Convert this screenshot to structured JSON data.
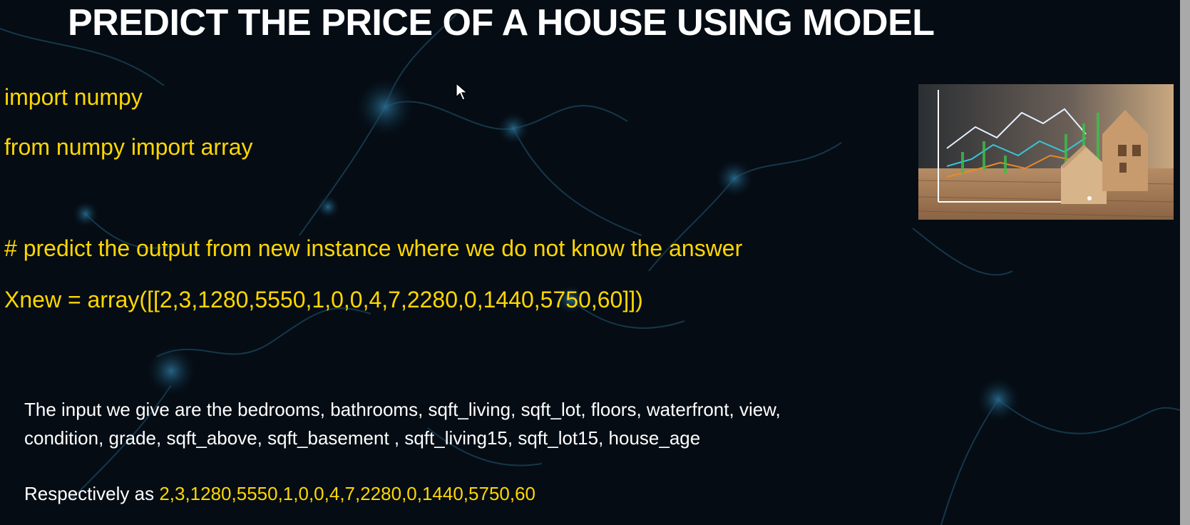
{
  "slide": {
    "title": "PREDICT THE PRICE OF A HOUSE USING MODEL"
  },
  "code": {
    "line1": "import numpy",
    "line2": "from numpy import array",
    "comment": "# predict the output from new instance where we do not know the answer",
    "xnew": "Xnew = array([[2,3,1280,5550,1,0,0,4,7,2280,0,1440,5750,60]])"
  },
  "description": {
    "line1": "The input we give are the bedrooms, bathrooms,  sqft_living,    sqft_lot, floors, waterfront, view,",
    "line2": "condition, grade, sqft_above, sqft_basement , sqft_living15, sqft_lot15, house_age",
    "respectively_prefix": "Respectively as ",
    "respectively_values": "2,3,1280,5550,1,0,0,4,7,2280,0,1440,5750,60"
  },
  "image": {
    "icon": "house-chart-photo"
  },
  "colors": {
    "background": "#050c14",
    "title": "#ffffff",
    "code": "#ffd700",
    "description": "#ffffff"
  }
}
